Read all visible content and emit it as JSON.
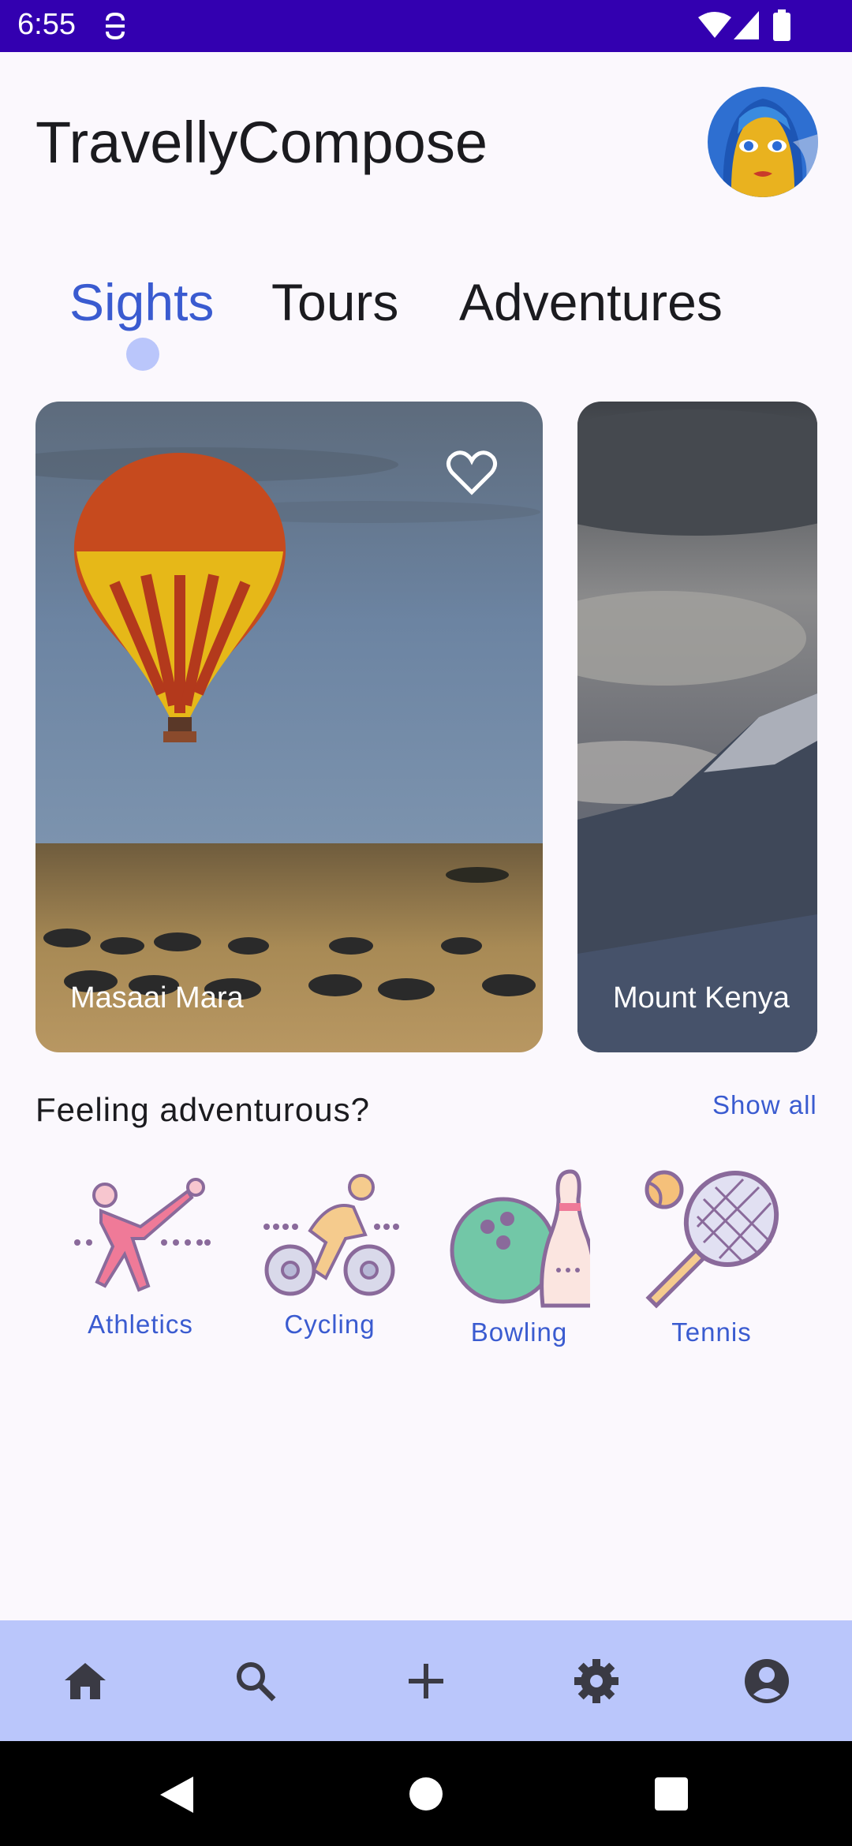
{
  "status_bar": {
    "time": "6:55"
  },
  "app": {
    "title": "TravellyCompose"
  },
  "tabs": [
    {
      "label": "Sights",
      "active": true
    },
    {
      "label": "Tours",
      "active": false
    },
    {
      "label": "Adventures",
      "active": false
    }
  ],
  "cards": [
    {
      "label": "Masaai Mara",
      "favorite": false
    },
    {
      "label": "Mount Kenya"
    }
  ],
  "section": {
    "title": "Feeling adventurous?",
    "show_all": "Show all"
  },
  "categories": [
    {
      "label": "Athletics",
      "icon": "athletics-icon"
    },
    {
      "label": "Cycling",
      "icon": "cycling-icon"
    },
    {
      "label": "Bowling",
      "icon": "bowling-icon"
    },
    {
      "label": "Tennis",
      "icon": "tennis-icon"
    }
  ],
  "bottom_nav": [
    {
      "icon": "home-icon"
    },
    {
      "icon": "search-icon"
    },
    {
      "icon": "add-icon"
    },
    {
      "icon": "settings-icon"
    },
    {
      "icon": "account-icon"
    }
  ],
  "colors": {
    "status_bar": "#3300b0",
    "accent": "#3a5bd0",
    "tab_indicator": "#bac6fb",
    "bottom_nav": "#bac6fb"
  }
}
